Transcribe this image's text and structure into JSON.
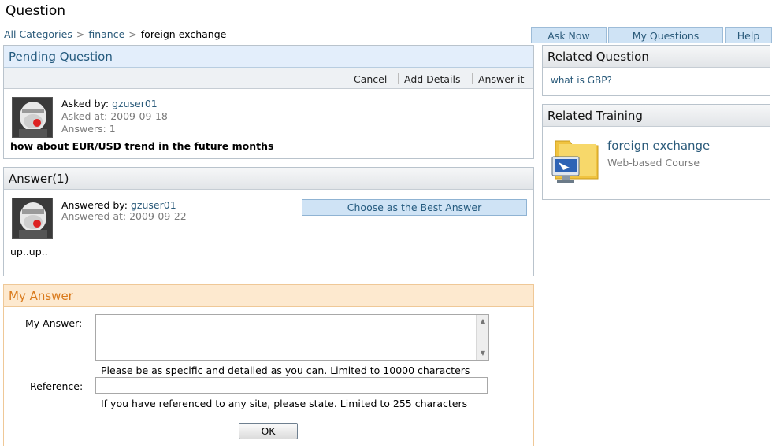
{
  "page": {
    "title": "Question"
  },
  "breadcrumb": {
    "items": [
      "All Categories",
      "finance",
      "foreign exchange"
    ],
    "separator": ">"
  },
  "nav_tabs": [
    "Ask Now",
    "My Questions",
    "Help"
  ],
  "pending": {
    "heading": "Pending Question",
    "actions": [
      "Cancel",
      "Add Details",
      "Answer it"
    ],
    "asked_by_label": "Asked by:",
    "asked_by_user": "gzuser01",
    "asked_at": "Asked at:  2009-09-18",
    "answers": "Answers:  1",
    "question": "how about EUR/USD trend in the future months"
  },
  "answers_section": {
    "heading": "Answer(1)",
    "answered_by_label": "Answered by:",
    "answered_by_user": "gzuser01",
    "answered_at": "Answered at:  2009-09-22",
    "best_button": "Choose as the Best Answer",
    "body": "up..up.."
  },
  "my_answer": {
    "heading": "My Answer",
    "answer_label": "My Answer:",
    "answer_value": "",
    "answer_hint": "Please be as specific and detailed as you can. Limited to 10000 characters",
    "reference_label": "Reference:",
    "reference_value": "",
    "reference_hint": "If you have referenced to any site, please state. Limited to 255 characters",
    "ok_button": "OK"
  },
  "related_question": {
    "heading": "Related Question",
    "items": [
      "what is GBP?"
    ]
  },
  "related_training": {
    "heading": "Related Training",
    "title": "foreign exchange",
    "subtitle": "Web-based Course"
  },
  "colors": {
    "link": "#2a5a7a",
    "tab_bg": "#cfe3f5",
    "pending_head_bg": "#e3eefb",
    "my_answer_head_bg": "#fde9cf",
    "my_answer_accent": "#d9791a"
  },
  "icons": [
    "avatar-image",
    "course-folder-icon",
    "scroll-up-arrow",
    "scroll-down-arrow"
  ]
}
